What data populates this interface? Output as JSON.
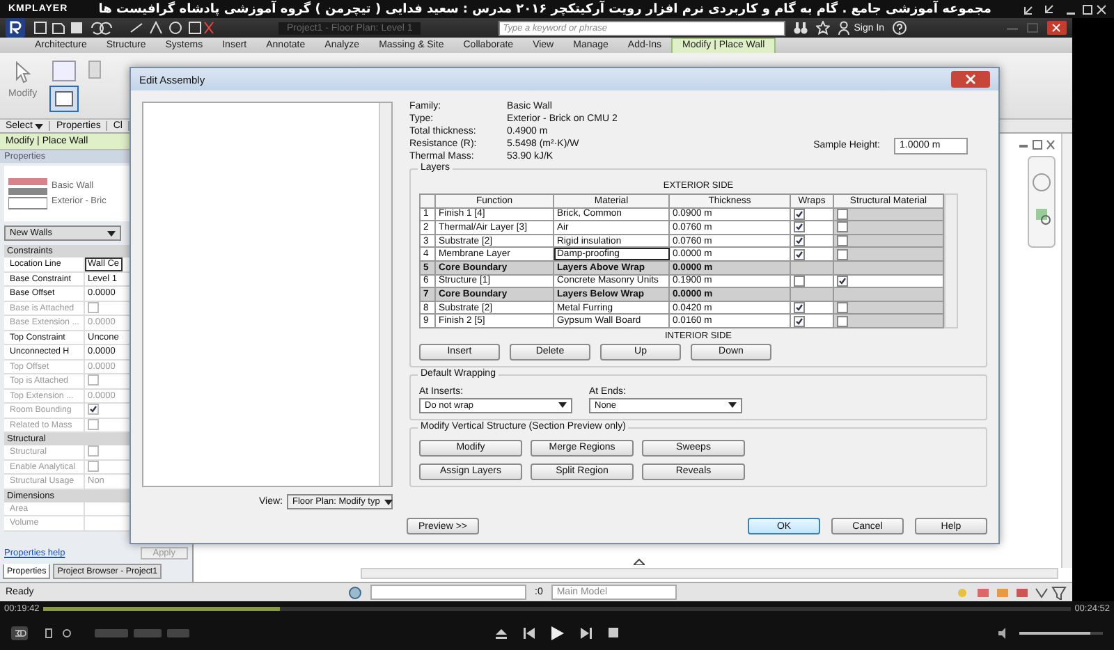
{
  "player": {
    "brand": "KMPLAYER",
    "title": "مجموعه آموزشی جامع . گام به گام و کاربردی نرم افزار رویت آرکیتکچر ۲۰۱۶  مدرس : سعید فدایی ( تیچرمن ) گروه آموزشی پادشاه گرافیست ها",
    "elapsed": "00:19:42",
    "total": "00:24:52",
    "progress": {
      "level": 0.23
    },
    "volume": {
      "level": 0.85
    }
  },
  "revit": {
    "window_title": "Project1 - Floor Plan: Level 1",
    "search": {
      "placeholder": "Type a keyword or phrase"
    },
    "sign_in": "Sign In",
    "ribbon_tabs": [
      {
        "label": "Architecture",
        "selected": false
      },
      {
        "label": "Structure",
        "selected": false
      },
      {
        "label": "Systems",
        "selected": false
      },
      {
        "label": "Insert",
        "selected": false
      },
      {
        "label": "Annotate",
        "selected": false
      },
      {
        "label": "Analyze",
        "selected": false
      },
      {
        "label": "Massing & Site",
        "selected": false
      },
      {
        "label": "Collaborate",
        "selected": false
      },
      {
        "label": "View",
        "selected": false
      },
      {
        "label": "Manage",
        "selected": false
      },
      {
        "label": "Add-Ins",
        "selected": false
      },
      {
        "label": "Modify | Place Wall",
        "selected": true
      }
    ],
    "ribbon": {
      "modify_tool": "Modify",
      "panel_labels": [
        {
          "label": "Select",
          "dropdown": true
        },
        {
          "label": "Properties",
          "dropdown": false
        },
        {
          "label": "Cl",
          "dropdown": false
        }
      ]
    },
    "context_bar": "Modify | Place Wall",
    "properties": {
      "title": "Properties",
      "type_family": "Basic Wall",
      "type_name": "Exterior - Bric",
      "filter": "New Walls",
      "sections": [
        {
          "title": "Constraints",
          "rows": [
            {
              "kind": "value",
              "label": "Location Line",
              "value": "Wall Ce",
              "disabled": false,
              "focused": true
            },
            {
              "kind": "value",
              "label": "Base Constraint",
              "value": "Level 1",
              "disabled": false,
              "focused": false
            },
            {
              "kind": "value",
              "label": "Base Offset",
              "value": "0.0000",
              "disabled": false,
              "focused": false
            },
            {
              "kind": "check",
              "label": "Base is Attached",
              "checked": false,
              "disabled": true
            },
            {
              "kind": "value",
              "label": "Base Extension ...",
              "value": "0.0000",
              "disabled": true,
              "focused": false
            },
            {
              "kind": "value",
              "label": "Top Constraint",
              "value": "Uncone",
              "disabled": false,
              "focused": false
            },
            {
              "kind": "value",
              "label": "Unconnected H",
              "value": "0.0000",
              "disabled": false,
              "focused": false
            },
            {
              "kind": "value",
              "label": "Top Offset",
              "value": "0.0000",
              "disabled": true,
              "focused": false
            },
            {
              "kind": "check",
              "label": "Top is Attached",
              "checked": false,
              "disabled": true
            },
            {
              "kind": "value",
              "label": "Top Extension ...",
              "value": "0.0000",
              "disabled": true,
              "focused": false
            },
            {
              "kind": "check",
              "label": "Room Bounding",
              "checked": true,
              "disabled": true
            },
            {
              "kind": "check",
              "label": "Related to Mass",
              "checked": false,
              "disabled": true
            }
          ]
        },
        {
          "title": "Structural",
          "rows": [
            {
              "kind": "check",
              "label": "Structural",
              "checked": false,
              "disabled": true
            },
            {
              "kind": "check",
              "label": "Enable Analytical",
              "checked": false,
              "disabled": true
            },
            {
              "kind": "value",
              "label": "Structural Usage",
              "value": "Non",
              "disabled": true,
              "focused": false
            }
          ]
        },
        {
          "title": "Dimensions",
          "rows": [
            {
              "kind": "value",
              "label": "Area",
              "value": "",
              "disabled": true,
              "focused": false
            },
            {
              "kind": "value",
              "label": "Volume",
              "value": "",
              "disabled": true,
              "focused": false
            }
          ]
        }
      ],
      "help_link": "Properties help",
      "apply": "Apply",
      "tabs": [
        {
          "label": "Properties",
          "selected": true
        },
        {
          "label": "Project Browser - Project1",
          "selected": false
        }
      ]
    },
    "status": {
      "text": "Ready",
      "counter": ":0",
      "model": "Main Model"
    }
  },
  "dialog": {
    "title": "Edit Assembly",
    "info": [
      {
        "label": "Family:",
        "value": "Basic Wall"
      },
      {
        "label": "Type:",
        "value": "Exterior - Brick on CMU 2"
      },
      {
        "label": "Total thickness:",
        "value": "0.4900 m"
      },
      {
        "label": "Resistance (R):",
        "value": "5.5498 (m²·K)/W"
      },
      {
        "label": "Thermal Mass:",
        "value": "53.90 kJ/K"
      }
    ],
    "sample_height": {
      "label": "Sample Height:",
      "value": "1.0000 m"
    },
    "layers": {
      "title": "Layers",
      "exterior_label": "EXTERIOR SIDE",
      "interior_label": "INTERIOR SIDE",
      "columns": [
        "Function",
        "Material",
        "Thickness",
        "Wraps",
        "Structural Material"
      ],
      "rows": [
        {
          "kind": "layer",
          "index": "1",
          "function": "Finish 1 [4]",
          "material": "Brick, Common",
          "thickness": "0.0900 m",
          "wraps": true,
          "structural": false,
          "editing": false
        },
        {
          "kind": "layer",
          "index": "2",
          "function": "Thermal/Air Layer [3]",
          "material": "Air",
          "thickness": "0.0760 m",
          "wraps": true,
          "structural": false,
          "editing": false
        },
        {
          "kind": "layer",
          "index": "3",
          "function": "Substrate [2]",
          "material": "Rigid insulation",
          "thickness": "0.0760 m",
          "wraps": true,
          "structural": false,
          "editing": false
        },
        {
          "kind": "layer",
          "index": "4",
          "function": "Membrane Layer",
          "material": "Damp-proofing",
          "thickness": "0.0000 m",
          "wraps": true,
          "structural": false,
          "editing": true
        },
        {
          "kind": "boundary",
          "index": "5",
          "function": "Core Boundary",
          "material": "Layers Above Wrap",
          "thickness": "0.0000 m"
        },
        {
          "kind": "layer",
          "index": "6",
          "function": "Structure [1]",
          "material": "Concrete Masonry Units",
          "thickness": "0.1900 m",
          "wraps": false,
          "structural": true,
          "editing": false
        },
        {
          "kind": "boundary",
          "index": "7",
          "function": "Core Boundary",
          "material": "Layers Below Wrap",
          "thickness": "0.0000 m"
        },
        {
          "kind": "layer",
          "index": "8",
          "function": "Substrate [2]",
          "material": "Metal Furring",
          "thickness": "0.0420 m",
          "wraps": true,
          "structural": false,
          "editing": false
        },
        {
          "kind": "layer",
          "index": "9",
          "function": "Finish 2 [5]",
          "material": "Gypsum Wall Board",
          "thickness": "0.0160 m",
          "wraps": true,
          "structural": false,
          "editing": false
        }
      ],
      "buttons": [
        "Insert",
        "Delete",
        "Up",
        "Down"
      ]
    },
    "wrapping": {
      "title": "Default Wrapping",
      "inserts_label": "At Inserts:",
      "inserts_value": "Do not wrap",
      "ends_label": "At Ends:",
      "ends_value": "None"
    },
    "vertical": {
      "title": "Modify Vertical Structure (Section Preview only)",
      "buttons": [
        "Modify",
        "Merge Regions",
        "Sweeps",
        "Assign Layers",
        "Split Region",
        "Reveals"
      ]
    },
    "view_label": "View:",
    "view_value": "Floor Plan: Modify typ",
    "preview_button": "Preview >>",
    "actions": [
      {
        "label": "OK",
        "default": true
      },
      {
        "label": "Cancel",
        "default": false
      },
      {
        "label": "Help",
        "default": false
      }
    ]
  }
}
